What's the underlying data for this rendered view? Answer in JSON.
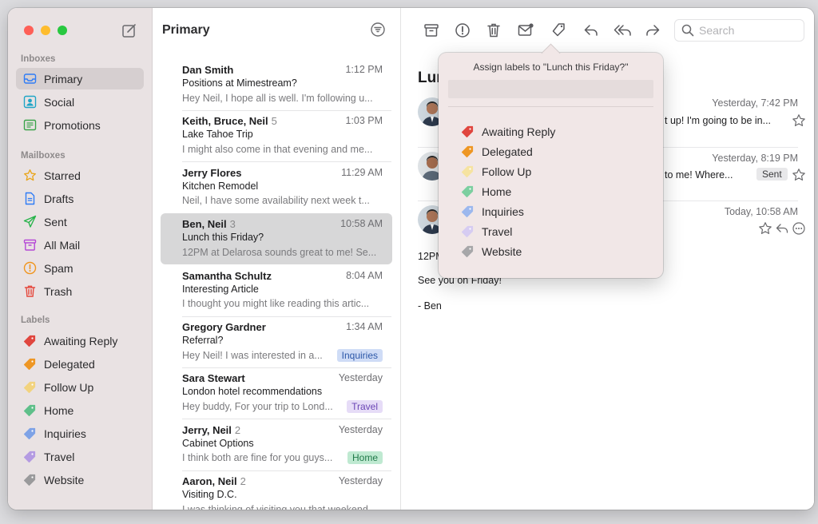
{
  "sidebar": {
    "inboxes_label": "Inboxes",
    "mailboxes_label": "Mailboxes",
    "labels_label": "Labels",
    "inboxes": [
      {
        "label": "Primary",
        "icon": "inbox-icon",
        "color": "#2e7cf6"
      },
      {
        "label": "Social",
        "icon": "person-icon",
        "color": "#1fa5c6"
      },
      {
        "label": "Promotions",
        "icon": "tag-icon",
        "color": "#3aa34a"
      }
    ],
    "mailboxes": [
      {
        "label": "Starred",
        "icon": "star-icon",
        "color": "#e9a51b"
      },
      {
        "label": "Drafts",
        "icon": "document-icon",
        "color": "#2e7cf6"
      },
      {
        "label": "Sent",
        "icon": "paper-plane-icon",
        "color": "#27b34a"
      },
      {
        "label": "All Mail",
        "icon": "archive-box-icon",
        "color": "#b548d6"
      },
      {
        "label": "Spam",
        "icon": "exclamation-circle-icon",
        "color": "#f0951e"
      },
      {
        "label": "Trash",
        "icon": "trash-icon",
        "color": "#e5483d"
      }
    ],
    "labels": [
      {
        "label": "Awaiting Reply",
        "color": "#e0463f"
      },
      {
        "label": "Delegated",
        "color": "#ee9624"
      },
      {
        "label": "Follow Up",
        "color": "#f2d37f"
      },
      {
        "label": "Home",
        "color": "#5fbf8a"
      },
      {
        "label": "Inquiries",
        "color": "#7ea2e6"
      },
      {
        "label": "Travel",
        "color": "#b49be2"
      },
      {
        "label": "Website",
        "color": "#9a9a9c"
      }
    ]
  },
  "list": {
    "title": "Primary",
    "messages": [
      {
        "sender": "Dan Smith",
        "count": "",
        "time": "1:12 PM",
        "subject": "Positions at Mimestream?",
        "preview": "Hey Neil, I hope all is well. I'm following u...",
        "tag": ""
      },
      {
        "sender": "Keith, Bruce, Neil",
        "count": "5",
        "time": "1:03 PM",
        "subject": "Lake Tahoe Trip",
        "preview": "I might also come in that evening and me...",
        "tag": ""
      },
      {
        "sender": "Jerry Flores",
        "count": "",
        "time": "11:29 AM",
        "subject": "Kitchen Remodel",
        "preview": "Neil, I have some availability next week t...",
        "tag": ""
      },
      {
        "sender": "Ben, Neil",
        "count": "3",
        "time": "10:58 AM",
        "subject": "Lunch this Friday?",
        "preview": "12PM at Delarosa sounds great to me! Se...",
        "tag": ""
      },
      {
        "sender": "Samantha Schultz",
        "count": "",
        "time": "8:04 AM",
        "subject": "Interesting Article",
        "preview": "I thought you might like reading this artic...",
        "tag": ""
      },
      {
        "sender": "Gregory Gardner",
        "count": "",
        "time": "1:34 AM",
        "subject": "Referral?",
        "preview": "Hey Neil! I was interested in a...",
        "tag": "Inquiries",
        "tag_bg": "#cfdcf6",
        "tag_fg": "#2c57a8"
      },
      {
        "sender": "Sara Stewart",
        "count": "",
        "time": "Yesterday",
        "subject": "London hotel recommendations",
        "preview": "Hey buddy, For your trip to Lond...",
        "tag": "Travel",
        "tag_bg": "#e6dcf7",
        "tag_fg": "#6b46b5"
      },
      {
        "sender": "Jerry, Neil",
        "count": "2",
        "time": "Yesterday",
        "subject": "Cabinet Options",
        "preview": "I think both are fine for you guys...",
        "tag": "Home",
        "tag_bg": "#bfe9d1",
        "tag_fg": "#217a4a"
      },
      {
        "sender": "Aaron, Neil",
        "count": "2",
        "time": "Yesterday",
        "subject": "Visiting D.C.",
        "preview": "I was thinking of visiting you that weekend...",
        "tag": ""
      }
    ]
  },
  "pane": {
    "search_placeholder": "Search",
    "title": "Lun",
    "thread": [
      {
        "time": "Yesterday, 7:42 PM",
        "snippet": "t up! I'm going to be in..."
      },
      {
        "time": "Yesterday, 8:19 PM",
        "snippet": "to me! Where...",
        "badge": "Sent"
      },
      {
        "time": "Today, 10:58 AM"
      }
    ],
    "body": [
      "12PM",
      "See you on Friday!",
      "- Ben"
    ]
  },
  "popover": {
    "title": "Assign labels to \"Lunch this Friday?\"",
    "items": [
      {
        "label": "Awaiting Reply",
        "color": "#e0463f"
      },
      {
        "label": "Delegated",
        "color": "#ee9624"
      },
      {
        "label": "Follow Up",
        "color": "#f6e3a1"
      },
      {
        "label": "Home",
        "color": "#7ccfa0"
      },
      {
        "label": "Inquiries",
        "color": "#9cb8ee"
      },
      {
        "label": "Travel",
        "color": "#d6ccf2"
      },
      {
        "label": "Website",
        "color": "#a7a7a9"
      }
    ]
  }
}
